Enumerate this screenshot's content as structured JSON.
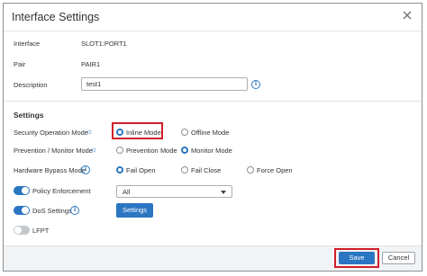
{
  "dialog": {
    "title": "Interface Settings"
  },
  "fields": {
    "interface_label": "Interface",
    "interface_value": "SLOT1:PORT1",
    "pair_label": "Pair",
    "pair_value": "PAIR1",
    "description_label": "Description",
    "description_value": "test1"
  },
  "settings": {
    "section_title": "Settings",
    "security_mode_label": "Security Operation Mode",
    "security_mode_options": [
      "Inline Mode",
      "Offline Mode"
    ],
    "security_mode_selected": "Inline Mode",
    "prevention_label": "Prevention / Monitor Mode",
    "prevention_options": [
      "Prevention Mode",
      "Monitor Mode"
    ],
    "prevention_selected": "Monitor Mode",
    "bypass_label": "Hardware Bypass Mode",
    "bypass_options": [
      "Fail Open",
      "Fail Close",
      "Force Open"
    ],
    "bypass_selected": "Fail Open",
    "policy_label": "Policy Enforcement",
    "policy_enabled": true,
    "policy_select_value": "All",
    "dos_label": "DoS Settings",
    "dos_enabled": true,
    "dos_button": "Settings",
    "lfpt_label": "LFPT",
    "lfpt_enabled": false
  },
  "footer": {
    "save": "Save",
    "cancel": "Cancel"
  },
  "icons": {
    "close": "close-icon",
    "info": "info-icon",
    "bulb": "lightbulb-icon",
    "caret": "chevron-down-icon"
  },
  "colors": {
    "accent": "#2b76c2",
    "highlight": "#d01f2a"
  }
}
